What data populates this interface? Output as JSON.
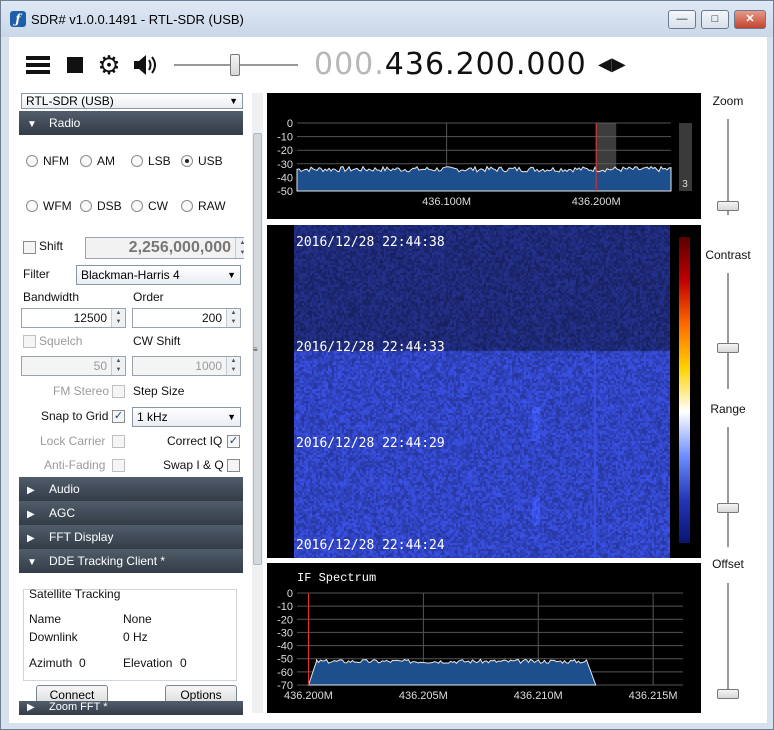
{
  "window": {
    "title": "SDR# v1.0.0.1491 - RTL-SDR (USB)",
    "logo_icon": "sdrsharp-logo-icon"
  },
  "window_controls": {
    "minimize": "—",
    "maximize": "□",
    "close": "✕"
  },
  "toolbar": {
    "menu_icon": "hamburger-icon",
    "stop_icon": "stop-icon",
    "settings_icon": "gear-icon",
    "audio_icon": "speaker-icon",
    "volume_level": 0.5,
    "frequency_prefix": "000.",
    "frequency_main": "436.200.000",
    "tune_arrows": "◀▶"
  },
  "source": {
    "selected": "RTL-SDR (USB)"
  },
  "radio": {
    "section_title": "Radio",
    "modes": [
      "NFM",
      "AM",
      "LSB",
      "USB",
      "WFM",
      "DSB",
      "CW",
      "RAW"
    ],
    "selected_mode": "USB",
    "shift_label": "Shift",
    "shift_value": "2,256,000,000",
    "filter_label": "Filter",
    "filter_value": "Blackman-Harris 4",
    "bandwidth_label": "Bandwidth",
    "bandwidth_value": "12500",
    "order_label": "Order",
    "order_value": "200",
    "squelch_label": "Squelch",
    "squelch_value": "50",
    "cw_shift_label": "CW Shift",
    "cw_shift_value": "1000",
    "fm_stereo_label": "FM Stereo",
    "step_size_label": "Step Size",
    "snap_label": "Snap to Grid",
    "step_value": "1 kHz",
    "lock_carrier_label": "Lock Carrier",
    "correct_iq_label": "Correct IQ",
    "anti_fading_label": "Anti-Fading",
    "swap_iq_label": "Swap I & Q",
    "check_mark": "✓"
  },
  "sections": {
    "audio": "Audio",
    "agc": "AGC",
    "fft": "FFT Display",
    "dde": "DDE Tracking Client *",
    "zoom_fft": "Zoom FFT *",
    "expanded_arrow": "▼",
    "collapsed_arrow": "▶"
  },
  "tracking": {
    "group_title": "Satellite Tracking",
    "name_label": "Name",
    "name_value": "None",
    "downlink_label": "Downlink",
    "downlink_value": "0 Hz",
    "azimuth_label": "Azimuth",
    "azimuth_value": "0",
    "elevation_label": "Elevation",
    "elevation_value": "0",
    "connect_label": "Connect",
    "options_label": "Options"
  },
  "spectrum": {
    "y_ticks": [
      "0",
      "-10",
      "-20",
      "-30",
      "-40",
      "-50"
    ],
    "x_ticks": [
      "436.100M",
      "436.200M"
    ],
    "scale_badge": "3",
    "noise_floor_db": -34,
    "tuned_mhz": 436.2,
    "x_range_mhz": [
      436.0,
      436.25
    ]
  },
  "waterfall": {
    "timestamps": [
      "2016/12/28 22:44:38",
      "2016/12/28 22:44:33",
      "2016/12/28 22:44:29",
      "2016/12/28 22:44:24"
    ]
  },
  "if_spectrum": {
    "title": "IF Spectrum",
    "y_ticks": [
      "0",
      "-10",
      "-20",
      "-30",
      "-40",
      "-50",
      "-60",
      "-70"
    ],
    "x_ticks": [
      "436.200M",
      "436.205M",
      "436.210M",
      "436.215M"
    ],
    "passband_mhz": [
      436.2,
      436.2125
    ],
    "passband_level_db": -52,
    "floor_db": -70
  },
  "side_sliders": {
    "zoom": {
      "label": "Zoom",
      "level": 0.05
    },
    "contrast": {
      "label": "Contrast",
      "level": 0.35
    },
    "range": {
      "label": "Range",
      "level": 0.3
    },
    "offset": {
      "label": "Offset",
      "level": 0.0
    }
  },
  "colors": {
    "accent": "#1f5fa8",
    "spectrum_fill": "#1c4f8c",
    "tuning_line": "#e03030",
    "waterfall_bg": "#1b2f8f"
  }
}
